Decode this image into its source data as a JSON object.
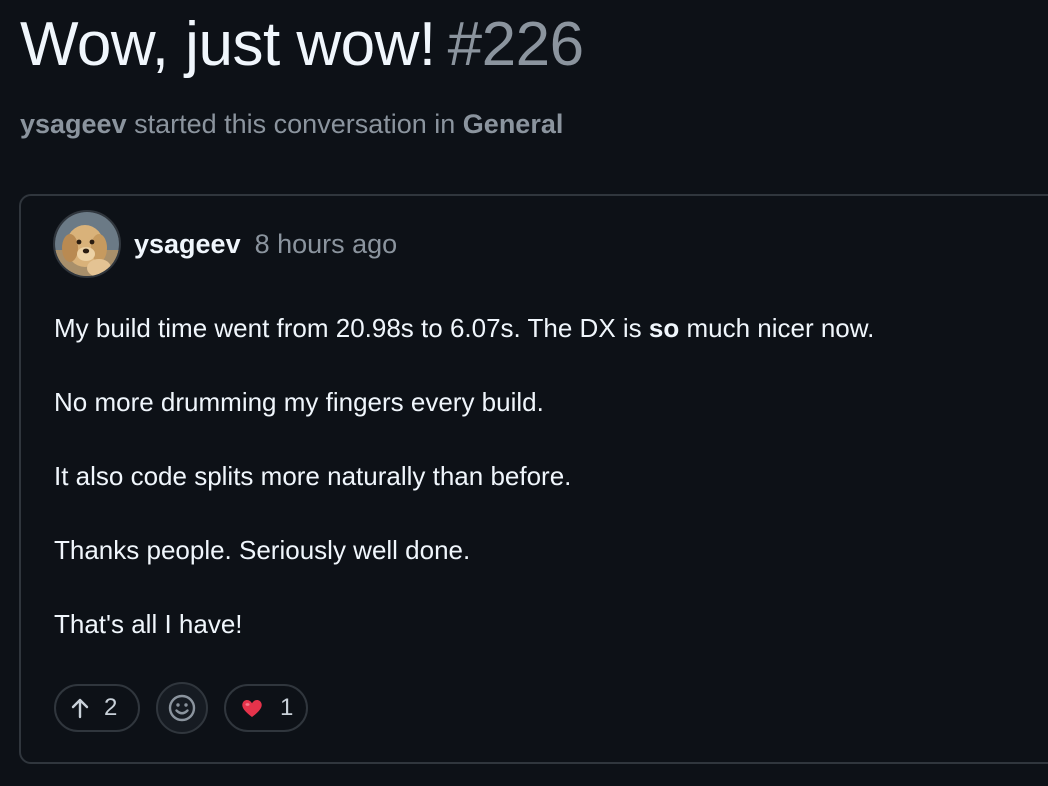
{
  "discussion": {
    "title": "Wow, just wow!",
    "number": "#226",
    "starter": "ysageev",
    "started_text": "started this conversation in",
    "category": "General"
  },
  "post": {
    "author": "ysageev",
    "timestamp": "8 hours ago",
    "paragraphs": {
      "p1_before": "My build time went from 20.98s to 6.07s. The DX is ",
      "p1_bold": "so",
      "p1_after": " much nicer now.",
      "p2": "No more drumming my fingers every build.",
      "p3": "It also code splits more naturally than before.",
      "p4": "Thanks people. Seriously well done.",
      "p5": "That's all I have!"
    }
  },
  "reactions": {
    "upvote_count": "2",
    "heart_count": "1"
  },
  "icons": {
    "upvote": "arrow-up-icon",
    "add_reaction": "smiley-icon",
    "heart": "heart-icon"
  },
  "colors": {
    "background": "#0d1117",
    "border": "#30363d",
    "muted": "#8b949e",
    "text": "#f0f6fc",
    "heart": "#e5334b"
  }
}
